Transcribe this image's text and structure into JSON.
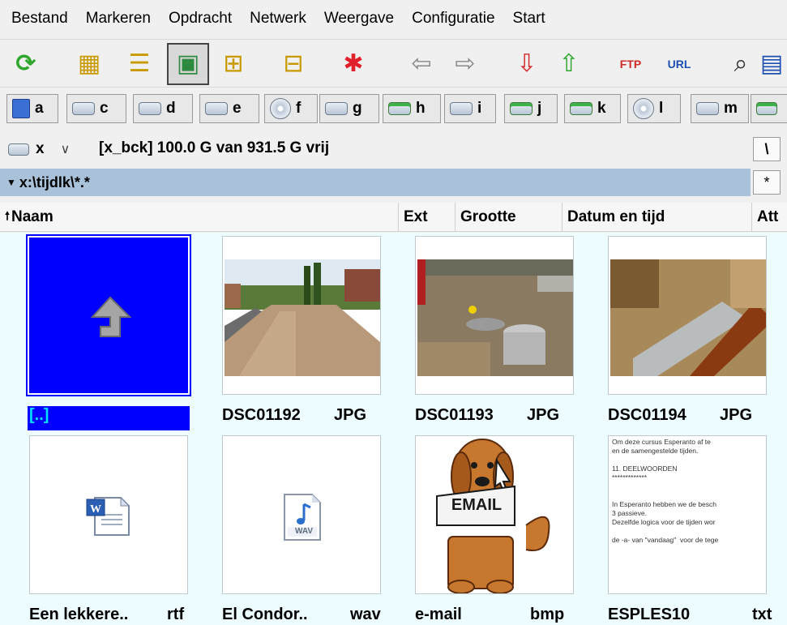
{
  "menu": [
    "Bestand",
    "Markeren",
    "Opdracht",
    "Netwerk",
    "Weergave",
    "Configuratie",
    "Start"
  ],
  "toolbar": {
    "buttons": [
      {
        "name": "refresh-button",
        "icon": "refresh-icon",
        "glyph": "⟳"
      },
      {
        "name": "brief-view-button",
        "icon": "brief-list-icon",
        "glyph": "▦"
      },
      {
        "name": "full-view-button",
        "icon": "full-list-icon",
        "glyph": "☰"
      },
      {
        "name": "thumbnail-view-button",
        "icon": "thumbnail-icon",
        "glyph": "▣"
      },
      {
        "name": "tree-view-button",
        "icon": "tree-icon",
        "glyph": "⊞"
      },
      {
        "name": "sync-tree-button",
        "icon": "tree-sync-icon",
        "glyph": "⊟"
      },
      {
        "name": "select-files-button",
        "icon": "asterisk-icon",
        "glyph": "✱"
      },
      {
        "name": "back-button",
        "icon": "back-arrow-icon",
        "glyph": "⇦"
      },
      {
        "name": "forward-button",
        "icon": "forward-arrow-icon",
        "glyph": "⇨"
      },
      {
        "name": "pack-button",
        "icon": "pack-icon",
        "glyph": "⇩"
      },
      {
        "name": "unpack-button",
        "icon": "unpack-icon",
        "glyph": "⇧"
      },
      {
        "name": "ftp-connect-button",
        "icon": "ftp-icon",
        "glyph": "FTP"
      },
      {
        "name": "url-connect-button",
        "icon": "url-icon",
        "glyph": "URL"
      },
      {
        "name": "search-button",
        "icon": "binoculars-icon",
        "glyph": "⌕"
      },
      {
        "name": "more-tools-button",
        "icon": "list-icon",
        "glyph": "▤"
      }
    ]
  },
  "drives": [
    {
      "letter": "a",
      "type": "floppy"
    },
    {
      "letter": "c",
      "type": "hdd"
    },
    {
      "letter": "d",
      "type": "hdd"
    },
    {
      "letter": "e",
      "type": "hdd"
    },
    {
      "letter": "f",
      "type": "cd"
    },
    {
      "letter": "g",
      "type": "hdd"
    },
    {
      "letter": "h",
      "type": "net"
    },
    {
      "letter": "i",
      "type": "hdd"
    },
    {
      "letter": "j",
      "type": "net"
    },
    {
      "letter": "k",
      "type": "net"
    },
    {
      "letter": "l",
      "type": "cd"
    },
    {
      "letter": "m",
      "type": "hdd"
    },
    {
      "letter": "",
      "type": "net"
    }
  ],
  "current_drive": "x",
  "drive_info": "[x_bck]  100.0 G van 931.5 G vrij",
  "root_label": "\\",
  "path": "x:\\tijdlk\\*.*",
  "star_label": "*",
  "columns": {
    "name": "Naam",
    "ext": "Ext",
    "size": "Grootte",
    "date": "Datum en tijd",
    "attr": "Att"
  },
  "files": [
    {
      "name": "[..]",
      "ext": "",
      "kind": "updir"
    },
    {
      "name": "DSC01192",
      "ext": "JPG",
      "kind": "photo-street"
    },
    {
      "name": "DSC01193",
      "ext": "JPG",
      "kind": "photo-pit"
    },
    {
      "name": "DSC01194",
      "ext": "JPG",
      "kind": "photo-pipe"
    },
    {
      "name": "Een lekkere..",
      "ext": "rtf",
      "kind": "word"
    },
    {
      "name": "El Condor..",
      "ext": "wav",
      "kind": "wav",
      "badge": "WAV"
    },
    {
      "name": "e-mail",
      "ext": "bmp",
      "kind": "email-dog",
      "badge": "EMAIL"
    },
    {
      "name": "ESPLES10",
      "ext": "txt",
      "kind": "text"
    }
  ],
  "text_preview": "Om deze cursus Esperanto af te\nen de samengestelde tijden.\n\n11. DEELWOORDEN\n*************\n\n\nIn Esperanto hebben we de besch\n3 passieve.\nDezelfde logica voor de tijden wor\n\nde -a- van \"vandaag\"  voor de tege"
}
